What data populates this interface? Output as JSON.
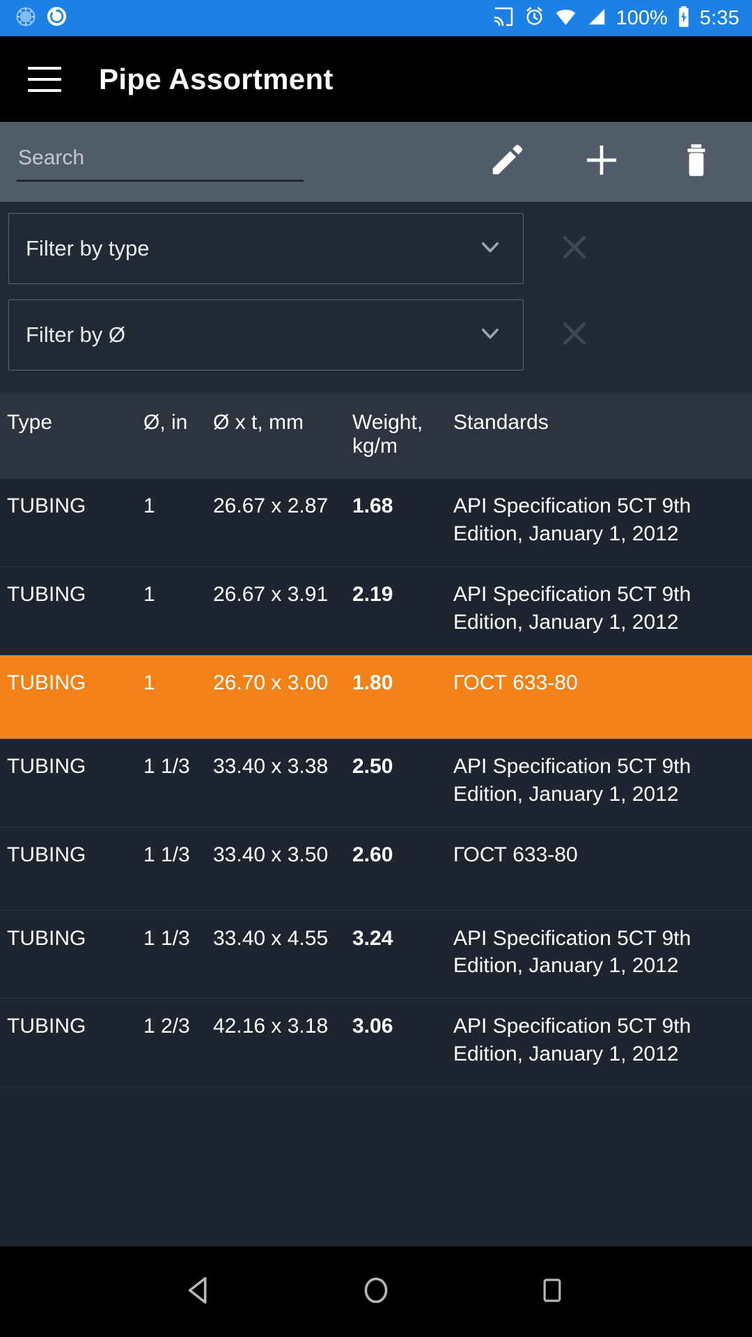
{
  "status_bar": {
    "background": "#1b81e5",
    "left_icons": [
      "sync-progress-icon",
      "refresh-circle-icon"
    ],
    "right_icons": [
      "cast-icon",
      "alarm-icon",
      "wifi-icon",
      "cellular-signal-icon",
      "battery-charging-icon"
    ],
    "battery_percent": "100%",
    "clock": "5:35"
  },
  "app_bar": {
    "background": "#000000",
    "menu_icon": "hamburger-menu-icon",
    "title": "Pipe Assortment"
  },
  "toolbar": {
    "background": "#515c6b",
    "search_placeholder": "Search",
    "search_value": "",
    "actions": [
      {
        "name": "edit-button",
        "icon": "pencil-icon"
      },
      {
        "name": "add-button",
        "icon": "plus-icon"
      },
      {
        "name": "delete-button",
        "icon": "trash-icon"
      }
    ]
  },
  "filters": [
    {
      "label": "Filter by type",
      "dropdown_icon": "chevron-down-icon",
      "clear_icon": "close-x-icon"
    },
    {
      "label": "Filter by Ø",
      "dropdown_icon": "chevron-down-icon",
      "clear_icon": "close-x-icon"
    }
  ],
  "table": {
    "headers": {
      "type": "Type",
      "diameter_in": "Ø, in",
      "diameter_thickness_mm": "Ø x t, mm",
      "weight": "Weight, kg/m",
      "standards": "Standards"
    },
    "selected_row_color": "#f28117",
    "rows": [
      {
        "type": "TUBING",
        "diameter_in": "1",
        "diameter_thickness_mm": "26.67 x 2.87",
        "weight": "1.68",
        "standards": "API Specification 5CT 9th Edition, January 1, 2012",
        "selected": false
      },
      {
        "type": "TUBING",
        "diameter_in": "1",
        "diameter_thickness_mm": "26.67 x 3.91",
        "weight": "2.19",
        "standards": "API Specification 5CT 9th Edition, January 1, 2012",
        "selected": false
      },
      {
        "type": "TUBING",
        "diameter_in": "1",
        "diameter_thickness_mm": "26.70 x 3.00",
        "weight": "1.80",
        "standards": "ГОСТ 633-80",
        "selected": true
      },
      {
        "type": "TUBING",
        "diameter_in": "1 1/3",
        "diameter_thickness_mm": "33.40 x 3.38",
        "weight": "2.50",
        "standards": "API Specification 5CT 9th Edition, January 1, 2012",
        "selected": false
      },
      {
        "type": "TUBING",
        "diameter_in": "1 1/3",
        "diameter_thickness_mm": "33.40 x 3.50",
        "weight": "2.60",
        "standards": "ГОСТ 633-80",
        "selected": false
      },
      {
        "type": "TUBING",
        "diameter_in": "1 1/3",
        "diameter_thickness_mm": "33.40 x 4.55",
        "weight": "3.24",
        "standards": "API Specification 5CT 9th Edition, January 1, 2012",
        "selected": false
      },
      {
        "type": "TUBING",
        "diameter_in": "1 2/3",
        "diameter_thickness_mm": "42.16 x 3.18",
        "weight": "3.06",
        "standards": "API Specification 5CT 9th Edition, January 1, 2012",
        "selected": false
      }
    ]
  },
  "nav_bar": {
    "background": "#000000",
    "buttons": [
      {
        "name": "nav-back-button",
        "icon": "triangle-back-icon"
      },
      {
        "name": "nav-home-button",
        "icon": "circle-home-icon"
      },
      {
        "name": "nav-recents-button",
        "icon": "square-recents-icon"
      }
    ]
  }
}
